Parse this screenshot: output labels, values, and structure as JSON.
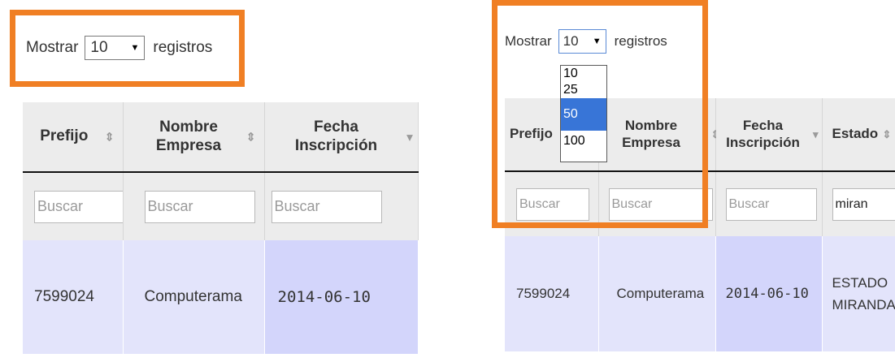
{
  "left": {
    "length_menu": {
      "prefix": "Mostrar",
      "value": "10",
      "suffix": "registros"
    },
    "columns": [
      {
        "label": "Prefijo",
        "sort_icon": "⇕"
      },
      {
        "label": "Nombre Empresa",
        "sort_icon": "⇕"
      },
      {
        "label": "Fecha Inscripción",
        "sort_icon": "▾"
      }
    ],
    "filters": [
      "Buscar",
      "Buscar",
      "Buscar"
    ],
    "row": [
      "7599024",
      "Computerama",
      "2014-06-10"
    ]
  },
  "right": {
    "length_menu": {
      "prefix": "Mostrar",
      "value": "10",
      "suffix": "registros"
    },
    "dropdown_options": [
      "10",
      "25",
      "50",
      "100"
    ],
    "dropdown_highlighted": "50",
    "columns": [
      {
        "label": "Prefijo",
        "sort_icon": "⇕"
      },
      {
        "label": "Nombre Empresa",
        "sort_icon": "⇕"
      },
      {
        "label": "Fecha Inscripción",
        "sort_icon": "▾"
      },
      {
        "label": "Estado",
        "sort_icon": "⇕"
      }
    ],
    "filters": [
      "Buscar",
      "Buscar",
      "Buscar",
      "miran"
    ],
    "row": [
      "7599024",
      "Computerama",
      "2014-06-10",
      "ESTADO MIRANDA"
    ]
  },
  "colors": {
    "highlight_border": "#f07f24",
    "row_bg": "#e3e4fb",
    "sorted_col_bg": "#d3d5fb",
    "option_selected": "#3875d7"
  }
}
